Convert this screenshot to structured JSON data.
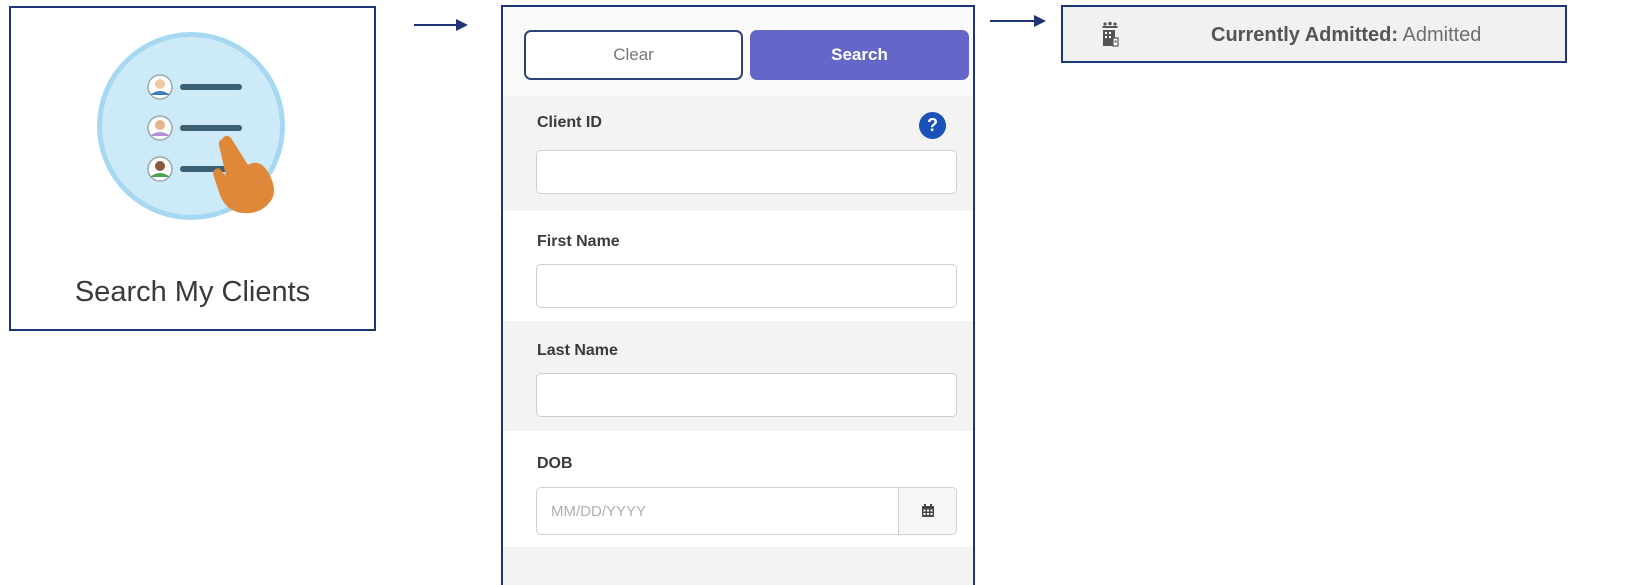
{
  "tile": {
    "label": "Search My Clients",
    "icon": "client-list-pointer-icon"
  },
  "search_panel": {
    "clear_label": "Clear",
    "search_label": "Search",
    "fields": [
      {
        "label": "Client ID",
        "value": "",
        "placeholder": ""
      },
      {
        "label": "First Name",
        "value": "",
        "placeholder": ""
      },
      {
        "label": "Last Name",
        "value": "",
        "placeholder": ""
      },
      {
        "label": "DOB",
        "value": "",
        "placeholder": "MM/DD/YYYY"
      }
    ],
    "help_glyph": "?",
    "calendar_icon": "calendar-icon"
  },
  "status_banner": {
    "icon": "building-people-icon",
    "key": "Currently Admitted:",
    "value": "Admitted"
  },
  "colors": {
    "frame": "#1f3575",
    "search_button": "#6467c8",
    "help_badge": "#1a52b8",
    "tile_circle": "#cdeaf8",
    "hand": "#e0883a"
  }
}
